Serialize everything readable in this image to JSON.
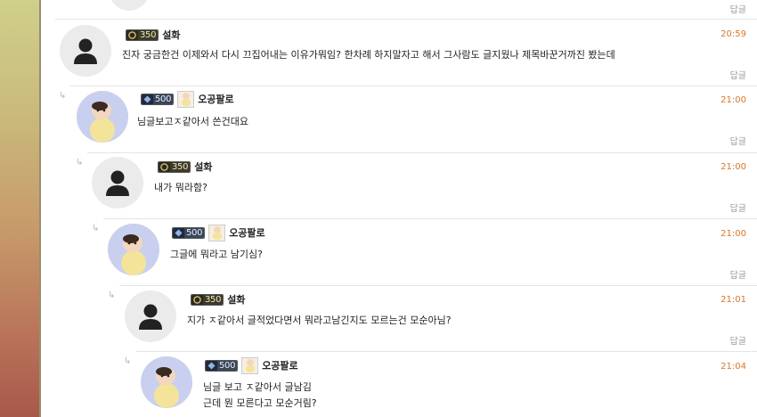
{
  "comments": [
    {
      "nick": "설화",
      "level": "350",
      "time": "20:59",
      "text": "진자 궁금한건 이제와서 다시 끄집어내는 이유가뭐임? 한차례 하지말자고 해서 그사람도 글지웠나 제목바꾼거까진 봤는데",
      "reply": "답글",
      "avatar": "default-user-icon"
    },
    {
      "nick": "오공팔로",
      "level": "500",
      "time": "21:00",
      "text": "님글보고ㅈ같아서 쓴건대요",
      "reply": "답글",
      "avatar": "character-avatar"
    },
    {
      "nick": "설화",
      "level": "350",
      "time": "21:00",
      "text": "내가 뭐라함?",
      "reply": "답글",
      "avatar": "default-user-icon"
    },
    {
      "nick": "오공팔로",
      "level": "500",
      "time": "21:00",
      "text": "그글에 뭐라고 남기심?",
      "reply": "답글",
      "avatar": "character-avatar"
    },
    {
      "nick": "설화",
      "level": "350",
      "time": "21:01",
      "text": "지가 ㅈ같아서 글적었다면서 뭐라고남긴지도 모르는건 모순아님?",
      "reply": "답글",
      "avatar": "default-user-icon"
    },
    {
      "nick": "오공팔로",
      "level": "500",
      "time": "21:04",
      "text_lines": [
        "님글 보고 ㅈ같아서 글남김",
        "근데 뭔 모른다고 모순거림?"
      ],
      "avatar": "character-avatar"
    }
  ],
  "top_reply": "답글",
  "reply_arrow": "↳",
  "colors": {
    "time": "#d9772a",
    "reply": "#9a9a9a",
    "separator": "#e4e4e4"
  }
}
